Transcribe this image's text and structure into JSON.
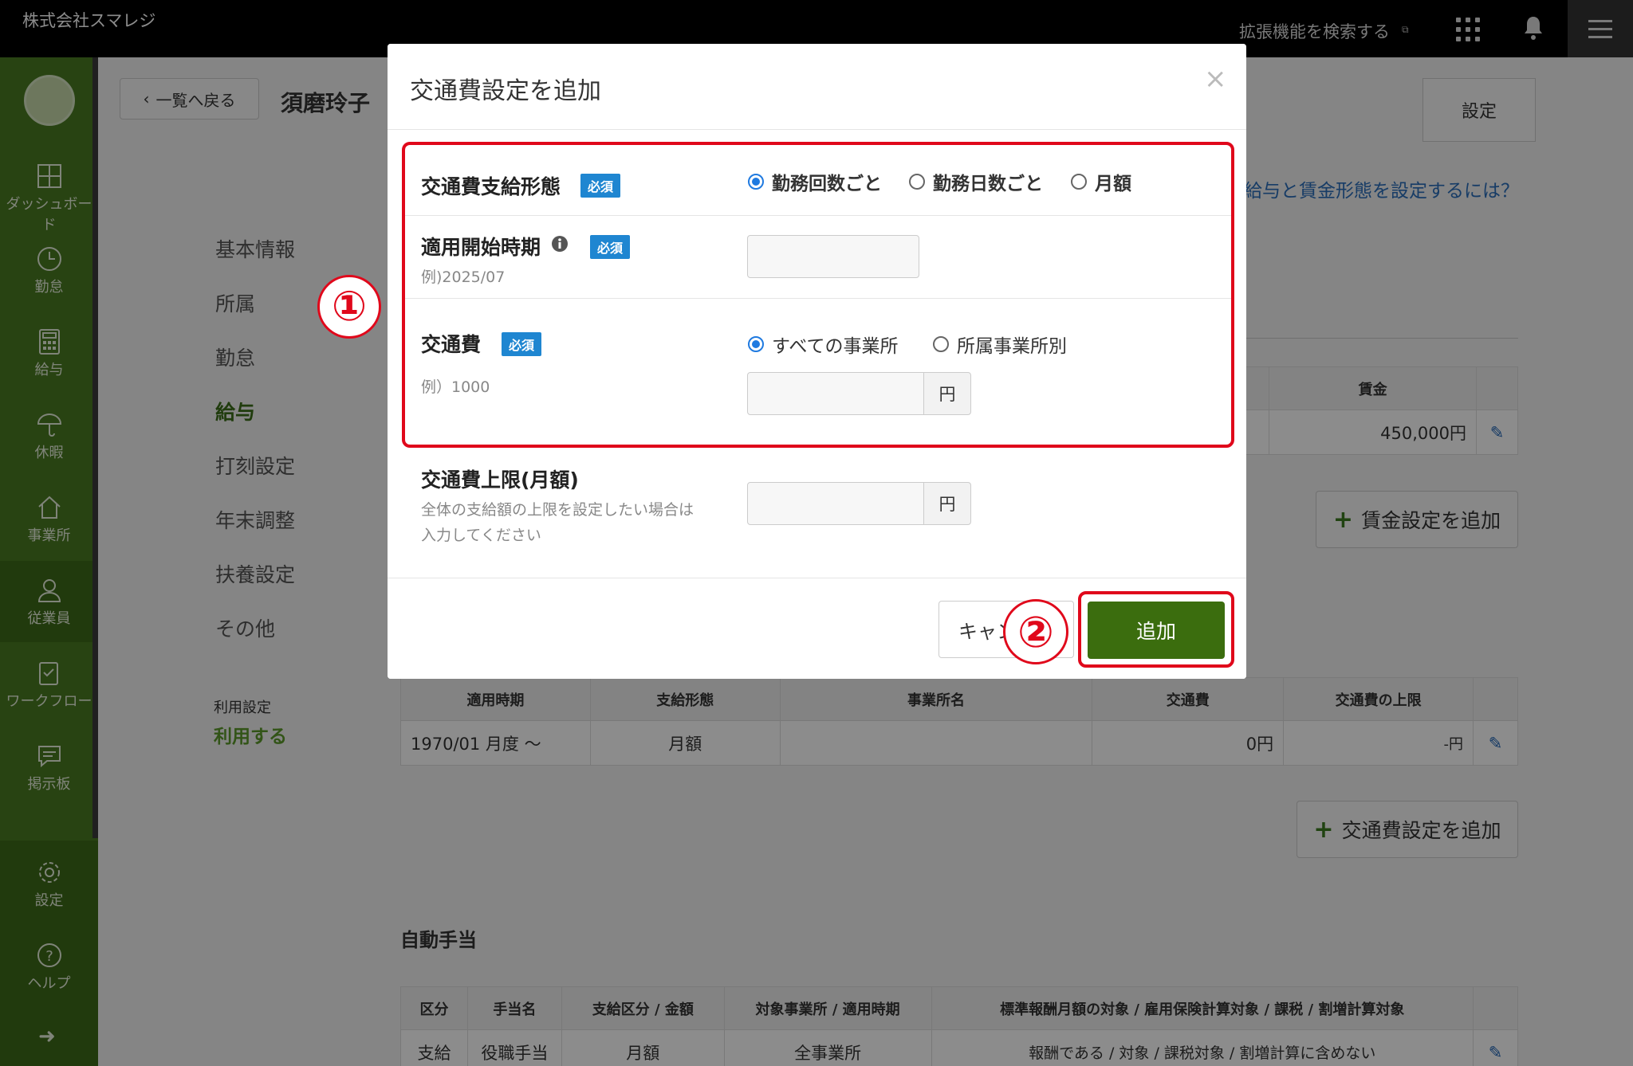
{
  "header": {
    "company": "株式会社スマレジ",
    "extension_search": "拡張機能を検索する",
    "extension_icon": "external-link-icon",
    "apps_icon": "grid-icon",
    "bell_icon": "bell-icon",
    "menu_icon": "hamburger-icon"
  },
  "sidebar": {
    "items": [
      {
        "label": "ダッシュボード",
        "icon": "dashboard-icon"
      },
      {
        "label": "勤怠",
        "icon": "clock-icon"
      },
      {
        "label": "給与",
        "icon": "calculator-icon"
      },
      {
        "label": "休暇",
        "icon": "umbrella-icon"
      },
      {
        "label": "事業所",
        "icon": "home-icon"
      },
      {
        "label": "従業員",
        "icon": "user-icon"
      },
      {
        "label": "ワークフロー",
        "icon": "clipboard-icon"
      },
      {
        "label": "掲示板",
        "icon": "message-icon"
      },
      {
        "label": "設定",
        "icon": "gear-icon"
      },
      {
        "label": "ヘルプ",
        "icon": "question-icon"
      }
    ],
    "expand_icon": "arrow-right-icon"
  },
  "page": {
    "back_label": "一覧へ戻る",
    "employee_name": "須磨玲子",
    "settings_label": "設定",
    "help_link": "給与と賃金形態を設定するには？",
    "left_nav": [
      "基本情報",
      "所属",
      "勤怠",
      "給与",
      "打刻設定",
      "年末調整",
      "扶養設定",
      "その他"
    ],
    "left_nav_active": "給与",
    "usage_label": "利用設定",
    "usage_value": "利用する"
  },
  "wage_table": {
    "header": "賃金",
    "value": "450,000円",
    "add_label": "賃金設定を追加"
  },
  "transport_table": {
    "headers": [
      "適用時期",
      "支給形態",
      "事業所名",
      "交通費",
      "交通費の上限"
    ],
    "row": [
      "1970/01 月度 〜",
      "月額",
      "",
      "0円",
      "-円"
    ],
    "add_label": "交通費設定を追加"
  },
  "auto_allowance": {
    "title": "自動手当",
    "headers": [
      "区分",
      "手当名",
      "支給区分 / 金額",
      "対象事業所 / 適用時期",
      "標準報酬月額の対象 / 雇用保険計算対象 / 課税 / 割増計算対象"
    ],
    "row": [
      "支給",
      "役職手当",
      "月額",
      "全事業所",
      "報酬である / 対象 / 課税対象 / 割増計算に含めない"
    ]
  },
  "modal": {
    "title": "交通費設定を追加",
    "close": "×",
    "required_badge": "必須",
    "payment_type": {
      "label": "交通費支給形態",
      "options": [
        "勤務回数ごと",
        "勤務日数ごと",
        "月額"
      ],
      "selected": "勤務回数ごと"
    },
    "start_period": {
      "label": "適用開始時期",
      "hint": "例)2025/07",
      "value": ""
    },
    "fare": {
      "label": "交通費",
      "hint": "例）1000",
      "options": [
        "すべての事業所",
        "所属事業所別"
      ],
      "selected": "すべての事業所",
      "unit": "円",
      "value": ""
    },
    "limit": {
      "label": "交通費上限(月額)",
      "hint_line1": "全体の支給額の上限を設定したい場合は",
      "hint_line2": "入力してください",
      "unit": "円",
      "value": ""
    },
    "cancel_label": "キャンセル",
    "submit_label": "追加"
  },
  "annotations": {
    "step1": "①",
    "step2": "②"
  },
  "colors": {
    "sidebar": "#4a7a22",
    "primary_button": "#3b6d0e",
    "required_badge": "#1f86d1",
    "annotation_red": "#e0081b"
  }
}
